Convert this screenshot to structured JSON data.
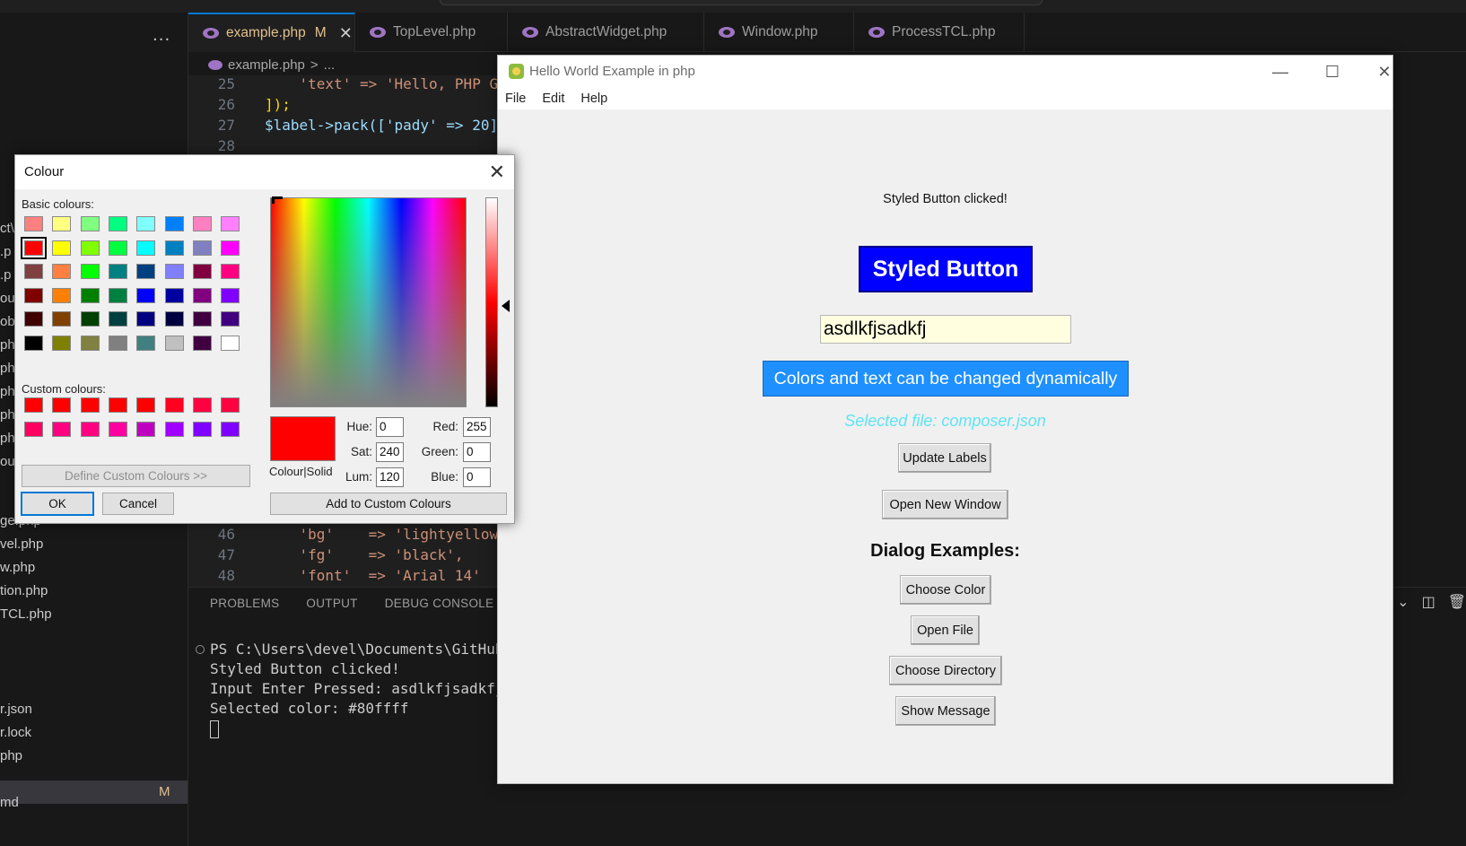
{
  "vscode": {
    "tabs": [
      {
        "label": "example.php",
        "modified": "M",
        "active": true
      },
      {
        "label": "TopLevel.php"
      },
      {
        "label": "AbstractWidget.php"
      },
      {
        "label": "Window.php"
      },
      {
        "label": "ProcessTCL.php"
      }
    ],
    "breadcrumb": {
      "file": "example.php",
      "sep": ">",
      "more": "..."
    },
    "explorer_items": [
      "ct\\",
      ".p",
      ".p",
      "ou",
      "ob",
      "ph",
      "ph",
      "ph",
      "ph",
      "ph",
      "ou",
      "ge.php",
      "vel.php",
      "w.php",
      "tion.php",
      "TCL.php",
      "r.json",
      "r.lock",
      "php",
      "md"
    ],
    "explorer_selected_flag": "M",
    "code_top": [
      {
        "ln": "25",
        "text": "    'text' => 'Hello, PHP G"
      },
      {
        "ln": "26",
        "text": "]);"
      },
      {
        "ln": "27",
        "text": "$label->pack(['pady' => 20]"
      },
      {
        "ln": "28",
        "text": ""
      }
    ],
    "code_bottom": [
      {
        "ln": "46",
        "text": "    'bg'    => 'lightyellow"
      },
      {
        "ln": "47",
        "text": "    'fg'    => 'black',"
      },
      {
        "ln": "48",
        "text": "    'font'  => 'Arial 14'"
      }
    ],
    "panel_tabs": [
      "PROBLEMS",
      "OUTPUT",
      "DEBUG CONSOLE"
    ],
    "terminal": [
      "PS C:\\Users\\devel\\Documents\\GitHub\\p",
      "Styled Button clicked!",
      "Input Enter Pressed: asdlkfjsadkfj",
      "Selected color: #80ffff"
    ]
  },
  "hello_window": {
    "title": "Hello World Example in php",
    "menu": [
      "File",
      "Edit",
      "Help"
    ],
    "status_label": "Styled Button clicked!",
    "styled_button": "Styled Button",
    "entry_value": "asdlkfjsadkfj",
    "dynamic_button": "Colors and text can be changed dynamically",
    "selected_file": "Selected file: composer.json",
    "update_labels": "Update Labels",
    "open_new_window": "Open New Window",
    "dialog_heading": "Dialog Examples:",
    "choose_color": "Choose Color",
    "open_file": "Open File",
    "choose_directory": "Choose Directory",
    "show_message": "Show Message",
    "colors": {
      "styled_bg": "#0000ff",
      "dynamic_bg": "#1e90ff",
      "entry_bg": "#ffffe0",
      "selected_file_fg": "#5ee3f5"
    }
  },
  "colour_dialog": {
    "title": "Colour",
    "basic_label": "Basic colours:",
    "custom_label": "Custom colours:",
    "basic_colours": [
      [
        "#ff8080",
        "#ffff80",
        "#80ff80",
        "#00ff80",
        "#80ffff",
        "#0080ff",
        "#ff80c0",
        "#ff80ff"
      ],
      [
        "#ff0000",
        "#ffff00",
        "#80ff00",
        "#00ff40",
        "#00ffff",
        "#0080c0",
        "#8080c0",
        "#ff00ff"
      ],
      [
        "#804040",
        "#ff8040",
        "#00ff00",
        "#008080",
        "#004080",
        "#8080ff",
        "#800040",
        "#ff0080"
      ],
      [
        "#800000",
        "#ff8000",
        "#008000",
        "#008040",
        "#0000ff",
        "#0000a0",
        "#800080",
        "#8000ff"
      ],
      [
        "#400000",
        "#804000",
        "#004000",
        "#004040",
        "#000080",
        "#000040",
        "#400040",
        "#400080"
      ],
      [
        "#000000",
        "#808000",
        "#808040",
        "#808080",
        "#408080",
        "#c0c0c0",
        "#400040",
        "#ffffff"
      ]
    ],
    "custom_colours": [
      [
        "#ff0000",
        "#ff0000",
        "#ff0000",
        "#ff0000",
        "#ff0000",
        "#ff0020",
        "#ff0040",
        "#ff0040"
      ],
      [
        "#ff0060",
        "#ff0080",
        "#ff0080",
        "#ff00a0",
        "#c000c0",
        "#a000ff",
        "#8000ff",
        "#8000ff"
      ]
    ],
    "define_custom": "Define Custom Colours >>",
    "ok": "OK",
    "cancel": "Cancel",
    "colour_solid": "Colour|Solid",
    "add_custom": "Add to Custom Colours",
    "hue_label": "Hue:",
    "hue": "0",
    "sat_label": "Sat:",
    "sat": "240",
    "lum_label": "Lum:",
    "lum": "120",
    "red_label": "Red:",
    "red": "255",
    "green_label": "Green:",
    "green": "0",
    "blue_label": "Blue:",
    "blue": "0",
    "selected_colour": "#ff0000"
  }
}
